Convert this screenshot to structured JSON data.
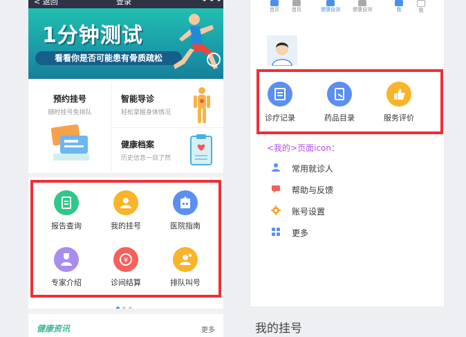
{
  "left_phone": {
    "nav": {
      "back": "< 返回",
      "title": "登录",
      "more": "•••"
    },
    "banner": {
      "headline": "1分钟测试",
      "subline": "看看你是否可能患有骨质疏松"
    },
    "services": [
      {
        "title": "预约挂号",
        "desc": "随时挂号免排队"
      },
      {
        "title": "智能导诊",
        "desc": "轻松掌握身体情况"
      },
      {
        "title": "健康档案",
        "desc": "历史信息一目了然"
      }
    ],
    "grid": [
      {
        "label": "报告查询",
        "icon": "report-icon",
        "color": "#2dc88a"
      },
      {
        "label": "我的挂号",
        "icon": "registration-icon",
        "color": "#f9b42a"
      },
      {
        "label": "医院指南",
        "icon": "hospital-guide-icon",
        "color": "#5b8ff0"
      },
      {
        "label": "专家介绍",
        "icon": "doctor-icon",
        "color": "#a88df0"
      },
      {
        "label": "诊间结算",
        "icon": "yuan-icon",
        "color": "#f4615b"
      },
      {
        "label": "排队叫号",
        "icon": "queue-icon",
        "color": "#f9b42a"
      }
    ],
    "news": {
      "title": "健康资讯",
      "more": "更多"
    }
  },
  "right_phone": {
    "tabs": [
      {
        "label": "首页"
      },
      {
        "label": "首页"
      },
      {
        "label": "健康自测"
      },
      {
        "label": "健康自测"
      },
      {
        "label": "我"
      },
      {
        "label": "我"
      }
    ],
    "boxed": [
      {
        "label": "诊疗记录",
        "icon": "medical-record-icon",
        "color": "#5b8ff0"
      },
      {
        "label": "药品目录",
        "icon": "drug-catalog-icon",
        "color": "#5b8ff0"
      },
      {
        "label": "服务评价",
        "icon": "thumbs-up-icon",
        "color": "#f9b42a"
      }
    ],
    "note": "<我的>页面icon：",
    "menu": [
      {
        "label": "常用就诊人",
        "icon": "patient-icon",
        "color": "#5b8ff0"
      },
      {
        "label": "帮助与反馈",
        "icon": "feedback-icon",
        "color": "#f4615b"
      },
      {
        "label": "账号设置",
        "icon": "settings-icon",
        "color": "#f9a42a"
      },
      {
        "label": "更多",
        "icon": "more-grid-icon",
        "color": "#5b8ff0"
      }
    ]
  },
  "caption": "我的挂号"
}
